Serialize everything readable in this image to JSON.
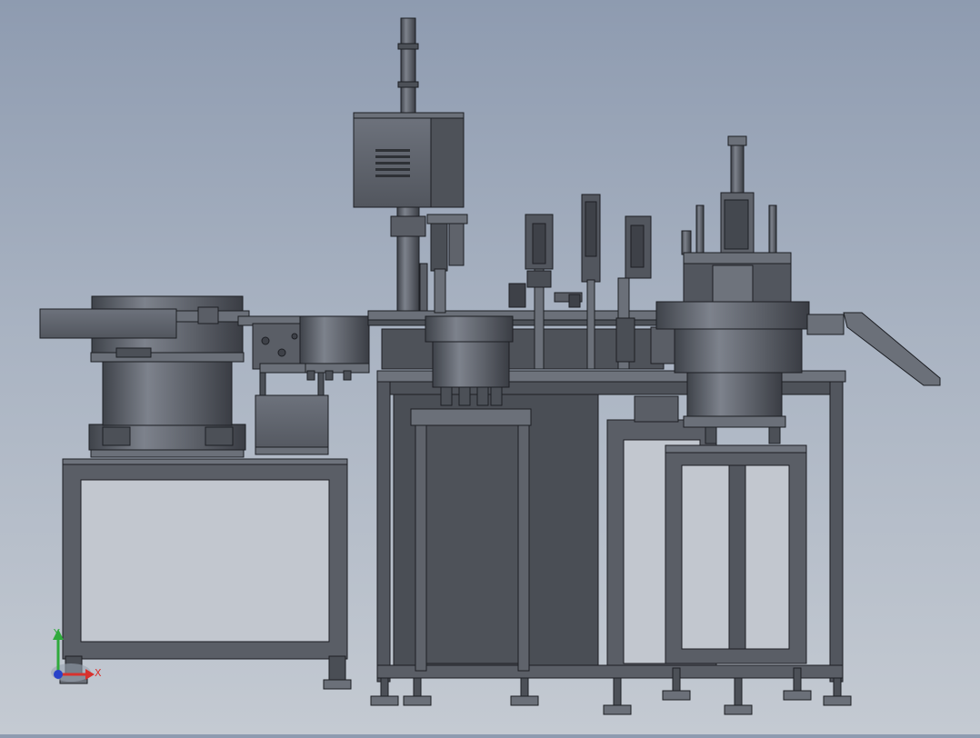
{
  "scene": {
    "view": "front",
    "background": {
      "top": "#8e9bb0",
      "bottom": "#c4cad2"
    },
    "colors": {
      "metal": "#5d616a",
      "metal_light": "#7b808a",
      "metal_dark": "#3e4148",
      "edge": "#1d1f24",
      "panel_open": "#c2c7cf"
    }
  },
  "triad": {
    "x_label": "X",
    "y_label": "Y",
    "x_color": "#d8322e",
    "y_color": "#2faa3c",
    "z_color": "#2a43c9"
  }
}
